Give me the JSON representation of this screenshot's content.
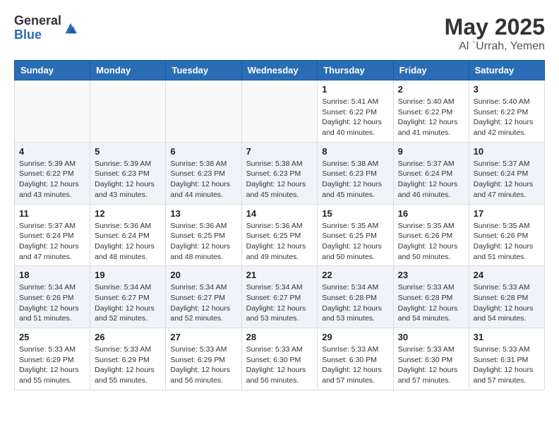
{
  "logo": {
    "general": "General",
    "blue": "Blue"
  },
  "title": "May 2025",
  "subtitle": "Al `Urrah, Yemen",
  "days_of_week": [
    "Sunday",
    "Monday",
    "Tuesday",
    "Wednesday",
    "Thursday",
    "Friday",
    "Saturday"
  ],
  "weeks": [
    [
      {
        "day": "",
        "info": ""
      },
      {
        "day": "",
        "info": ""
      },
      {
        "day": "",
        "info": ""
      },
      {
        "day": "",
        "info": ""
      },
      {
        "day": "1",
        "info": "Sunrise: 5:41 AM\nSunset: 6:22 PM\nDaylight: 12 hours\nand 40 minutes."
      },
      {
        "day": "2",
        "info": "Sunrise: 5:40 AM\nSunset: 6:22 PM\nDaylight: 12 hours\nand 41 minutes."
      },
      {
        "day": "3",
        "info": "Sunrise: 5:40 AM\nSunset: 6:22 PM\nDaylight: 12 hours\nand 42 minutes."
      }
    ],
    [
      {
        "day": "4",
        "info": "Sunrise: 5:39 AM\nSunset: 6:22 PM\nDaylight: 12 hours\nand 43 minutes."
      },
      {
        "day": "5",
        "info": "Sunrise: 5:39 AM\nSunset: 6:23 PM\nDaylight: 12 hours\nand 43 minutes."
      },
      {
        "day": "6",
        "info": "Sunrise: 5:38 AM\nSunset: 6:23 PM\nDaylight: 12 hours\nand 44 minutes."
      },
      {
        "day": "7",
        "info": "Sunrise: 5:38 AM\nSunset: 6:23 PM\nDaylight: 12 hours\nand 45 minutes."
      },
      {
        "day": "8",
        "info": "Sunrise: 5:38 AM\nSunset: 6:23 PM\nDaylight: 12 hours\nand 45 minutes."
      },
      {
        "day": "9",
        "info": "Sunrise: 5:37 AM\nSunset: 6:24 PM\nDaylight: 12 hours\nand 46 minutes."
      },
      {
        "day": "10",
        "info": "Sunrise: 5:37 AM\nSunset: 6:24 PM\nDaylight: 12 hours\nand 47 minutes."
      }
    ],
    [
      {
        "day": "11",
        "info": "Sunrise: 5:37 AM\nSunset: 6:24 PM\nDaylight: 12 hours\nand 47 minutes."
      },
      {
        "day": "12",
        "info": "Sunrise: 5:36 AM\nSunset: 6:24 PM\nDaylight: 12 hours\nand 48 minutes."
      },
      {
        "day": "13",
        "info": "Sunrise: 5:36 AM\nSunset: 6:25 PM\nDaylight: 12 hours\nand 48 minutes."
      },
      {
        "day": "14",
        "info": "Sunrise: 5:36 AM\nSunset: 6:25 PM\nDaylight: 12 hours\nand 49 minutes."
      },
      {
        "day": "15",
        "info": "Sunrise: 5:35 AM\nSunset: 6:25 PM\nDaylight: 12 hours\nand 50 minutes."
      },
      {
        "day": "16",
        "info": "Sunrise: 5:35 AM\nSunset: 6:26 PM\nDaylight: 12 hours\nand 50 minutes."
      },
      {
        "day": "17",
        "info": "Sunrise: 5:35 AM\nSunset: 6:26 PM\nDaylight: 12 hours\nand 51 minutes."
      }
    ],
    [
      {
        "day": "18",
        "info": "Sunrise: 5:34 AM\nSunset: 6:26 PM\nDaylight: 12 hours\nand 51 minutes."
      },
      {
        "day": "19",
        "info": "Sunrise: 5:34 AM\nSunset: 6:27 PM\nDaylight: 12 hours\nand 52 minutes."
      },
      {
        "day": "20",
        "info": "Sunrise: 5:34 AM\nSunset: 6:27 PM\nDaylight: 12 hours\nand 52 minutes."
      },
      {
        "day": "21",
        "info": "Sunrise: 5:34 AM\nSunset: 6:27 PM\nDaylight: 12 hours\nand 53 minutes."
      },
      {
        "day": "22",
        "info": "Sunrise: 5:34 AM\nSunset: 6:28 PM\nDaylight: 12 hours\nand 53 minutes."
      },
      {
        "day": "23",
        "info": "Sunrise: 5:33 AM\nSunset: 6:28 PM\nDaylight: 12 hours\nand 54 minutes."
      },
      {
        "day": "24",
        "info": "Sunrise: 5:33 AM\nSunset: 6:28 PM\nDaylight: 12 hours\nand 54 minutes."
      }
    ],
    [
      {
        "day": "25",
        "info": "Sunrise: 5:33 AM\nSunset: 6:29 PM\nDaylight: 12 hours\nand 55 minutes."
      },
      {
        "day": "26",
        "info": "Sunrise: 5:33 AM\nSunset: 6:29 PM\nDaylight: 12 hours\nand 55 minutes."
      },
      {
        "day": "27",
        "info": "Sunrise: 5:33 AM\nSunset: 6:29 PM\nDaylight: 12 hours\nand 56 minutes."
      },
      {
        "day": "28",
        "info": "Sunrise: 5:33 AM\nSunset: 6:30 PM\nDaylight: 12 hours\nand 56 minutes."
      },
      {
        "day": "29",
        "info": "Sunrise: 5:33 AM\nSunset: 6:30 PM\nDaylight: 12 hours\nand 57 minutes."
      },
      {
        "day": "30",
        "info": "Sunrise: 5:33 AM\nSunset: 6:30 PM\nDaylight: 12 hours\nand 57 minutes."
      },
      {
        "day": "31",
        "info": "Sunrise: 5:33 AM\nSunset: 6:31 PM\nDaylight: 12 hours\nand 57 minutes."
      }
    ]
  ]
}
